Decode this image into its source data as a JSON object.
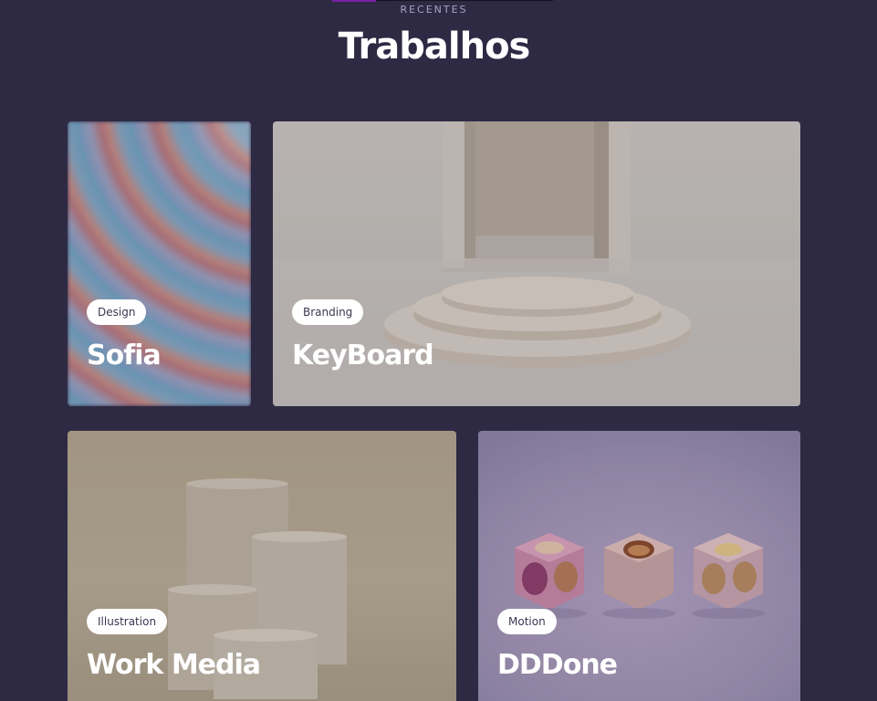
{
  "section": {
    "eyebrow": "RECENTES",
    "title": "Trabalhos"
  },
  "colors": {
    "background": "#2e2a44",
    "accent": "#7a1fa2",
    "tag_background": "#ffffff",
    "tag_text": "#3b3752",
    "title_text": "#ffffff"
  },
  "projects": [
    {
      "tag": "Design",
      "title": "Sofia"
    },
    {
      "tag": "Branding",
      "title": "KeyBoard"
    },
    {
      "tag": "Illustration",
      "title": "Work Media"
    },
    {
      "tag": "Motion",
      "title": "DDDone"
    }
  ]
}
